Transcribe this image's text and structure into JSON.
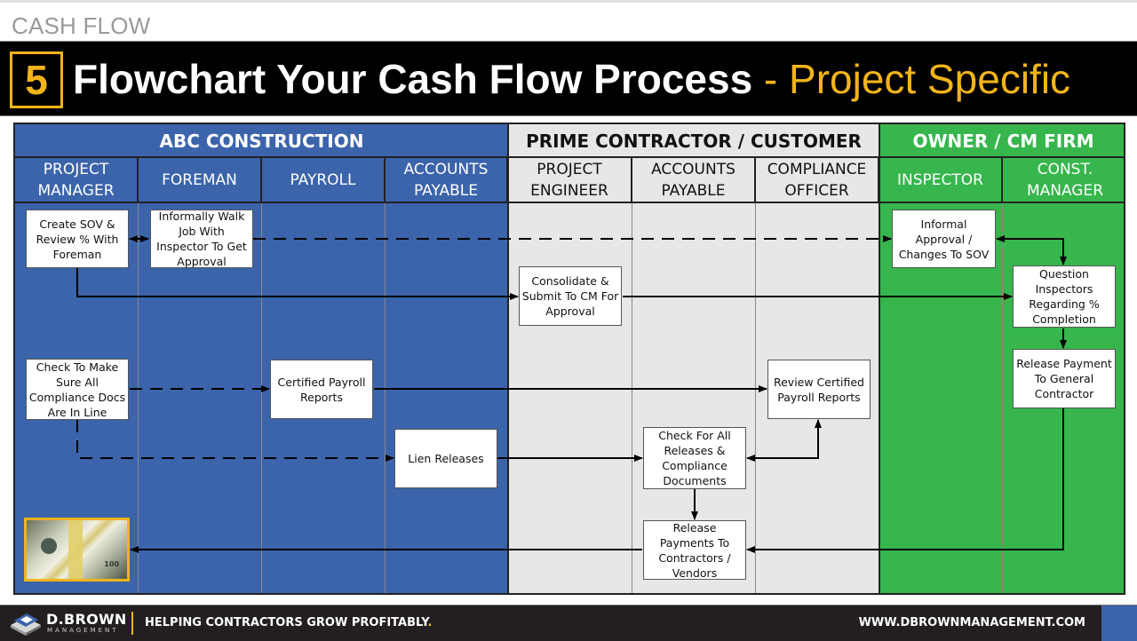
{
  "header": {
    "section_label": "CASH FLOW",
    "step_number": "5",
    "title_main": "Flowchart Your Cash Flow Process",
    "title_sub": " - Project Specific"
  },
  "colors": {
    "abc_construction": "#3b64ab",
    "prime_contractor": "#e7e7e7",
    "owner_cm": "#37b64d",
    "accent": "#f2b419"
  },
  "groups": [
    {
      "label": "ABC CONSTRUCTION"
    },
    {
      "label": "PRIME CONTRACTOR / CUSTOMER"
    },
    {
      "label": "OWNER / CM FIRM"
    }
  ],
  "lanes": [
    {
      "label": "PROJECT\nMANAGER"
    },
    {
      "label": "FOREMAN"
    },
    {
      "label": "PAYROLL"
    },
    {
      "label": "ACCOUNTS\nPAYABLE"
    },
    {
      "label": "PROJECT\nENGINEER"
    },
    {
      "label": "ACCOUNTS\nPAYABLE"
    },
    {
      "label": "COMPLIANCE\nOFFICER"
    },
    {
      "label": "INSPECTOR"
    },
    {
      "label": "CONST.\nMANAGER"
    }
  ],
  "nodes": {
    "create_sov": "Create SOV & Review % With Foreman",
    "walk_job": "Informally Walk Job With Inspector To Get Approval",
    "informal_approval": "Informal Approval / Changes To SOV",
    "consolidate": "Consolidate & Submit To CM For Approval",
    "question_inspectors": "Question Inspectors Regarding % Completion",
    "release_payment_gc": "Release Payment To General Contractor",
    "check_compliance": "Check To Make Sure All Compliance Docs Are In Line",
    "certified_payroll": "Certified Payroll Reports",
    "review_payroll": "Review Certified Payroll Reports",
    "lien_releases": "Lien Releases",
    "check_releases": "Check For All Releases & Compliance Documents",
    "release_payments_vendors": "Release Payments To Contractors / Vendors",
    "money_image": "stack of cash (image)"
  },
  "edges": [
    {
      "from": "create_sov",
      "to": "walk_job",
      "style": "solid",
      "direction": "both"
    },
    {
      "from": "walk_job",
      "to": "informal_approval",
      "style": "dashed",
      "direction": "forward"
    },
    {
      "from": "informal_approval",
      "to": "question_inspectors",
      "style": "solid",
      "direction": "both"
    },
    {
      "from": "create_sov",
      "to": "consolidate",
      "style": "solid",
      "direction": "forward"
    },
    {
      "from": "consolidate",
      "to": "question_inspectors",
      "style": "solid",
      "direction": "forward"
    },
    {
      "from": "question_inspectors",
      "to": "release_payment_gc",
      "style": "solid",
      "direction": "forward"
    },
    {
      "from": "check_compliance",
      "to": "certified_payroll",
      "style": "dashed",
      "direction": "forward"
    },
    {
      "from": "certified_payroll",
      "to": "review_payroll",
      "style": "solid",
      "direction": "forward"
    },
    {
      "from": "check_compliance",
      "to": "lien_releases",
      "style": "dashed",
      "direction": "forward"
    },
    {
      "from": "lien_releases",
      "to": "check_releases",
      "style": "solid",
      "direction": "forward"
    },
    {
      "from": "check_releases",
      "to": "review_payroll",
      "style": "solid",
      "direction": "both"
    },
    {
      "from": "check_releases",
      "to": "release_payments_vendors",
      "style": "solid",
      "direction": "forward"
    },
    {
      "from": "release_payment_gc",
      "to": "release_payments_vendors",
      "style": "solid",
      "direction": "forward"
    },
    {
      "from": "release_payments_vendors",
      "to": "money_image",
      "style": "solid",
      "direction": "forward"
    }
  ],
  "footer": {
    "brand_name": "D.BROWN",
    "brand_sub": "MANAGEMENT",
    "tagline": "HELPING CONTRACTORS GROW PROFITABLY",
    "tagline_dot": ".",
    "website": "WWW.DBROWNMANAGEMENT.COM"
  }
}
